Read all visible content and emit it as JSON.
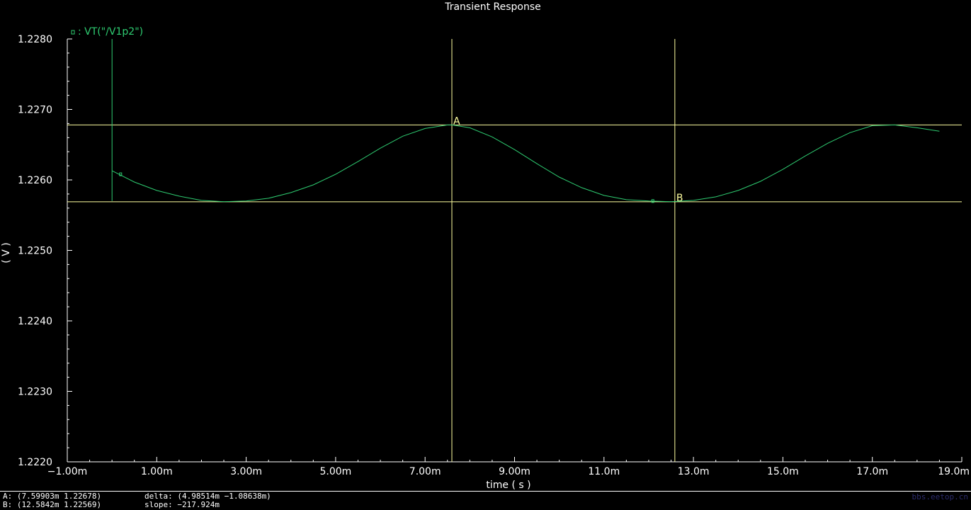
{
  "chart_data": {
    "type": "line",
    "title": "Transient Response",
    "xlabel": "time ( s )",
    "ylabel": "( V )",
    "xlim": [
      -0.001,
      0.019
    ],
    "ylim": [
      1.222,
      1.228
    ],
    "x_ticks": [
      "−1.00m",
      "1.00m",
      "3.00m",
      "5.00m",
      "7.00m",
      "9.00m",
      "11.0m",
      "13.0m",
      "15.0m",
      "17.0m",
      "19.0m"
    ],
    "y_ticks": [
      "1.2280",
      "1.2270",
      "1.2260",
      "1.2250",
      "1.2240",
      "1.2230",
      "1.2220"
    ],
    "series": [
      {
        "name": "VT(\"/V1p2\")",
        "legend_text": ": VT(\"/V1p2\")",
        "color": "#2ecc71",
        "x": [
          0.0,
          0.0,
          0.0,
          0.0005,
          0.001,
          0.0015,
          0.002,
          0.0025,
          0.003,
          0.0035,
          0.004,
          0.0045,
          0.005,
          0.0055,
          0.006,
          0.0065,
          0.007,
          0.0075,
          0.0076,
          0.008,
          0.0085,
          0.009,
          0.0095,
          0.01,
          0.0105,
          0.011,
          0.0115,
          0.012,
          0.0125,
          0.013,
          0.0135,
          0.014,
          0.0145,
          0.015,
          0.0155,
          0.016,
          0.0165,
          0.017,
          0.0175,
          0.018,
          0.0185
        ],
        "y": [
          1.228,
          1.2257,
          1.22613,
          1.22597,
          1.22585,
          1.22577,
          1.22571,
          1.22569,
          1.2257,
          1.22574,
          1.22582,
          1.22593,
          1.22608,
          1.22626,
          1.22645,
          1.22662,
          1.22673,
          1.22678,
          1.22678,
          1.22674,
          1.22661,
          1.22643,
          1.22623,
          1.22604,
          1.22589,
          1.22578,
          1.22572,
          1.2257,
          1.22569,
          1.22571,
          1.22576,
          1.22585,
          1.22598,
          1.22615,
          1.22634,
          1.22652,
          1.22667,
          1.22677,
          1.22678,
          1.22674,
          1.22669
        ]
      }
    ],
    "markers": [
      {
        "label": "A",
        "x": 0.007599,
        "y": 1.22678
      },
      {
        "label": "B",
        "x": 0.0125842,
        "y": 1.22569
      }
    ],
    "colors": {
      "background": "#000000",
      "axis": "#ffffff",
      "cursor": "#ffffa0",
      "trace": "#2ecc71"
    }
  },
  "status": {
    "a_readout": "A: (7.59903m 1.22678)",
    "b_readout": "B: (12.5842m 1.22569)",
    "delta": "delta: (4.98514m −1.08638m)",
    "slope": "slope: −217.924m"
  },
  "watermark": "bbs.eetop.cn"
}
